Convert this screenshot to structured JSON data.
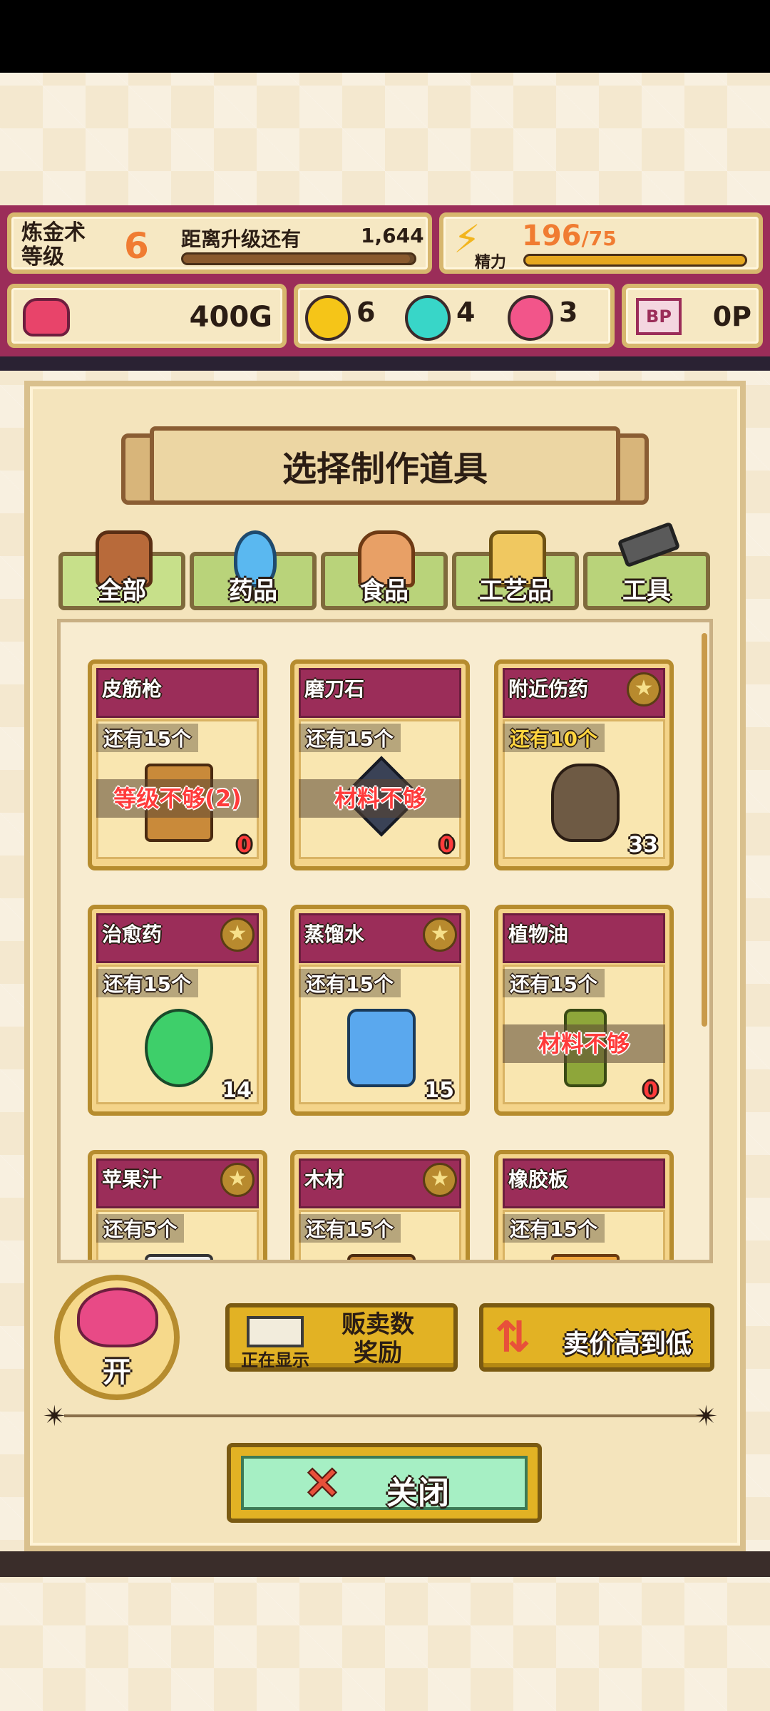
{
  "header": {
    "level_label": "炼金术\n等级",
    "level_value": "6",
    "exp_label": "距离升级还有",
    "exp_value": "1,644",
    "exp_fill": 0.98,
    "energy_label": "精力",
    "energy_value": "196",
    "energy_max": "/75",
    "energy_fill": 1.0
  },
  "resources": {
    "gold": "400G",
    "yellow_orbs": "6",
    "cyan_orbs": "4",
    "pink_orbs": "3",
    "bp_icon_text": "BP",
    "bp": "0P",
    "colors": {
      "yellow": "#f5c518",
      "cyan": "#38d6c8",
      "pink": "#f2558a"
    }
  },
  "dialog": {
    "title": "选择制作道具",
    "tabs": [
      {
        "label": "全部",
        "icon": "bag-icon"
      },
      {
        "label": "药品",
        "icon": "potion-icon"
      },
      {
        "label": "食品",
        "icon": "bread-icon"
      },
      {
        "label": "工艺品",
        "icon": "figurine-icon"
      },
      {
        "label": "工具",
        "icon": "hammer-icon"
      }
    ],
    "items": [
      {
        "name": "皮筋枪",
        "remain": "还有15个",
        "warn": "等级不够(2)",
        "count": "0",
        "star": false
      },
      {
        "name": "磨刀石",
        "remain": "还有15个",
        "warn": "材料不够",
        "count": "0",
        "star": false
      },
      {
        "name": "附近伤药",
        "remain": "还有10个",
        "warn": "",
        "count": "33",
        "star": true
      },
      {
        "name": "治愈药",
        "remain": "还有15个",
        "warn": "",
        "count": "14",
        "star": true
      },
      {
        "name": "蒸馏水",
        "remain": "还有15个",
        "warn": "",
        "count": "15",
        "star": true
      },
      {
        "name": "植物油",
        "remain": "还有15个",
        "warn": "材料不够",
        "count": "0",
        "star": false
      },
      {
        "name": "苹果汁",
        "remain": "还有5个",
        "warn": "",
        "count": "",
        "star": true
      },
      {
        "name": "木材",
        "remain": "还有15个",
        "warn": "",
        "count": "",
        "star": true
      },
      {
        "name": "橡胶板",
        "remain": "还有15个",
        "warn": "",
        "count": "",
        "star": false
      }
    ],
    "npc_label": "开",
    "sales_button": {
      "main": "贩卖数\n奖励",
      "sub": "正在显示"
    },
    "sort_button": "卖价高到低",
    "close_button": "关闭",
    "star_glyph": "★"
  }
}
